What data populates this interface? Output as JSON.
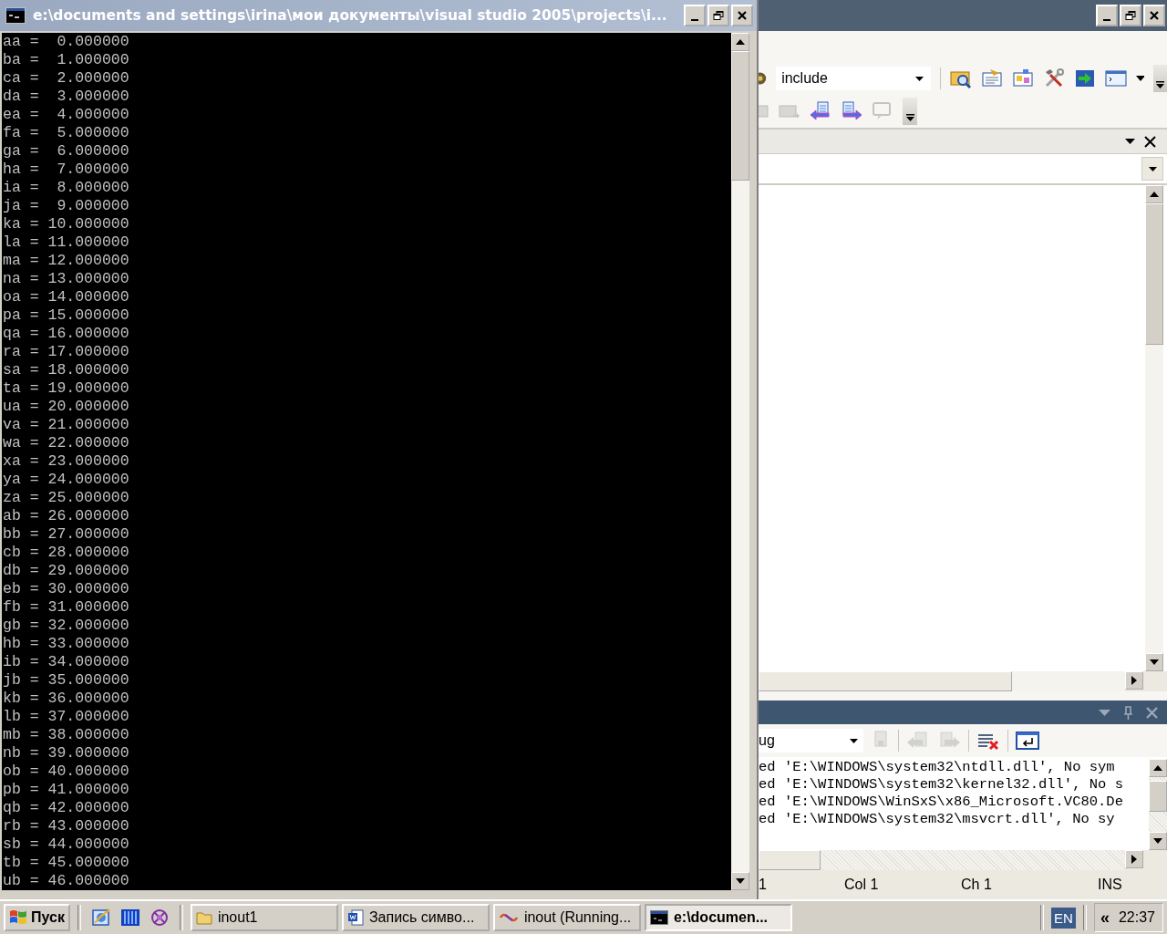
{
  "console_window": {
    "title": "e:\\documents and settings\\irina\\мои документы\\visual studio 2005\\projects\\i...",
    "lines": [
      "aa =  0.000000",
      "ba =  1.000000",
      "ca =  2.000000",
      "da =  3.000000",
      "ea =  4.000000",
      "fa =  5.000000",
      "ga =  6.000000",
      "ha =  7.000000",
      "ia =  8.000000",
      "ja =  9.000000",
      "ka = 10.000000",
      "la = 11.000000",
      "ma = 12.000000",
      "na = 13.000000",
      "oa = 14.000000",
      "pa = 15.000000",
      "qa = 16.000000",
      "ra = 17.000000",
      "sa = 18.000000",
      "ta = 19.000000",
      "ua = 20.000000",
      "va = 21.000000",
      "wa = 22.000000",
      "xa = 23.000000",
      "ya = 24.000000",
      "za = 25.000000",
      "ab = 26.000000",
      "bb = 27.000000",
      "cb = 28.000000",
      "db = 29.000000",
      "eb = 30.000000",
      "fb = 31.000000",
      "gb = 32.000000",
      "hb = 33.000000",
      "ib = 34.000000",
      "jb = 35.000000",
      "kb = 36.000000",
      "lb = 37.000000",
      "mb = 38.000000",
      "nb = 39.000000",
      "ob = 40.000000",
      "pb = 41.000000",
      "qb = 42.000000",
      "rb = 43.000000",
      "sb = 44.000000",
      "tb = 45.000000",
      "ub = 46.000000"
    ]
  },
  "ide_window": {
    "find_combo": {
      "value": "include"
    },
    "output_panel": {
      "config_value": "ug",
      "lines": [
        "ed 'E:\\WINDOWS\\system32\\ntdll.dll', No sym",
        "ed 'E:\\WINDOWS\\system32\\kernel32.dll', No s",
        "ed 'E:\\WINDOWS\\WinSxS\\x86_Microsoft.VC80.De",
        "ed 'E:\\WINDOWS\\system32\\msvcrt.dll', No sy"
      ]
    },
    "status_bar": [
      "1",
      "Col 1",
      "Ch 1",
      "INS"
    ]
  },
  "taskbar": {
    "start_label": "Пуск",
    "tasks": [
      {
        "kind": "folder",
        "label": "inout1",
        "selected": false
      },
      {
        "kind": "document",
        "label": "Запись симво...",
        "selected": false
      },
      {
        "kind": "studio",
        "label": "inout (Running...",
        "selected": false
      },
      {
        "kind": "console",
        "label": "e:\\documen...",
        "selected": true
      }
    ],
    "language": "EN",
    "tray_toggle": "«",
    "clock": "22:37"
  }
}
